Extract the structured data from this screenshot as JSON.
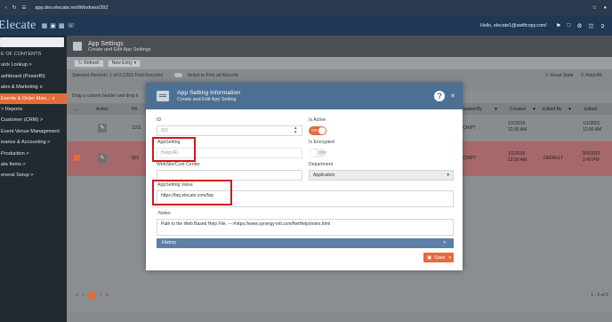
{
  "browser": {
    "url": "app.dev.elecate.net/Windows/392"
  },
  "header": {
    "logo": "Elecate",
    "user": "Hello, elecate1@swiftcopy.com!"
  },
  "sidebar": {
    "items": [
      {
        "label": "E OF CONTENTS",
        "kind": "head"
      },
      {
        "label": "uick Lookup  >"
      },
      {
        "label": "ashboard (PowerBI)"
      },
      {
        "label": "ales & Marketing  ∨"
      },
      {
        "label": "Events & Order Man...  ∨",
        "kind": "active"
      },
      {
        "label": "> Reports"
      },
      {
        "label": "Customer (CRM)  >"
      },
      {
        "label": "Event Venue Management"
      },
      {
        "label": "inance & Accounting  >"
      },
      {
        "label": "Production  >"
      },
      {
        "label": "ata Items  >"
      },
      {
        "label": "eneral Setup  >"
      }
    ]
  },
  "page": {
    "title": "App Settings",
    "subtitle": "Create and Edit App Settings"
  },
  "toolbar": {
    "refresh": "Refresh",
    "new_entry": "New Entry"
  },
  "selection": {
    "selected_text": "Selected Records: 1 of 0 (1253 Total Records)",
    "print_text": "Select to Print all Records",
    "reset_state": "Reset State",
    "search_placeholder": "HelpURL"
  },
  "grid": {
    "drag_hint": "Drag a column header and drop it",
    "columns": {
      "action": "Action",
      "pk": "PK",
      "created_by": "Created By",
      "created": "Created",
      "edited_by": "Edited By",
      "edited": "Edited"
    },
    "rows": [
      {
        "pk": "1101",
        "created_by": "SCRIPT",
        "created": "1/1/2010\n12:00 AM",
        "edited_by": "",
        "edited": "1/1/2001\n12:00 AM"
      },
      {
        "pk": "801",
        "created_by": "SCRIPT",
        "created": "1/1/2010\n12:00 AM",
        "edited_by": "DEFAULT",
        "edited": "9/9/2022\n2:40 PM"
      }
    ],
    "pager": {
      "page": "1",
      "total": "1 - 2 of 2"
    }
  },
  "modal": {
    "title": "App Setting Information",
    "subtitle": "Create and Edit App Setting",
    "id_label": "ID",
    "id_value": "801",
    "is_active_label": "Is Active",
    "is_active_value": "ON",
    "appsetting_label": "AppSetting",
    "appsetting_value": "HelpURL",
    "is_encrypted_label": "Is Encrypted",
    "is_encrypted_value": "OFF",
    "website_label": "WebSite/Cost Center",
    "website_value": "",
    "department_label": "Department",
    "department_value": "Application",
    "value_label": "AppSetting Value",
    "value_value": "https://faq.elecate.com/faq",
    "notes_label": "Notes",
    "notes_value": "Path to the Web Based Help File.  --->https://www.synergy-intl.com/NetHelp/index.html",
    "history_label": "History",
    "save_label": "Save"
  },
  "colors": {
    "accent": "#e46b3a",
    "modal_header": "#4c6f94",
    "highlight": "#d0161f"
  }
}
